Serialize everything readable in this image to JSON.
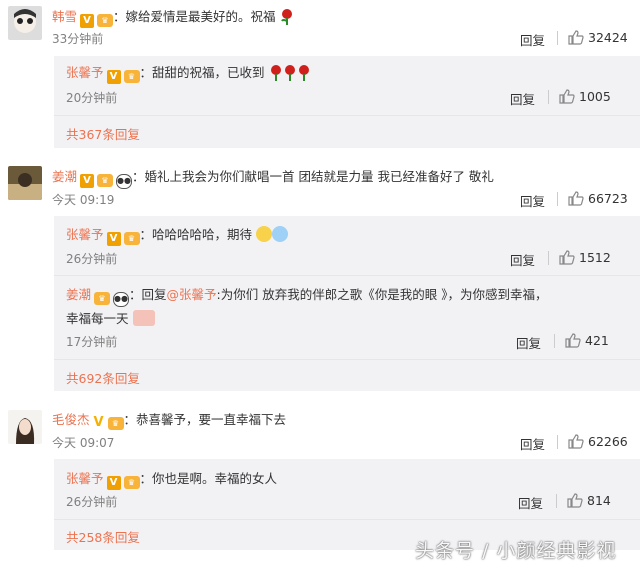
{
  "comments": [
    {
      "user": "韩雪",
      "text": "：嫁给爱情是最美好的。祝福",
      "time": "33分钟前",
      "reply_label": "回复",
      "likes": "32424",
      "subs": [
        {
          "user": "张馨予",
          "text": "：甜甜的祝福，已收到",
          "time": "20分钟前",
          "reply_label": "回复",
          "likes": "1005"
        }
      ],
      "more": "共367条回复"
    },
    {
      "user": "姜潮",
      "text": "：婚礼上我会为你们献唱一首 团结就是力量 我已经准备好了 敬礼",
      "time": "今天 09:19",
      "reply_label": "回复",
      "likes": "66723",
      "subs": [
        {
          "user": "张馨予",
          "text": "：哈哈哈哈哈，期待",
          "time": "26分钟前",
          "reply_label": "回复",
          "likes": "1512"
        },
        {
          "user": "姜潮",
          "reply_prefix": "：回复",
          "mention": "@张馨予",
          "text": ":为你们 放弃我的伴郎之歌《你是我的眼 》，为你感到幸福，",
          "text2": "幸福每一天",
          "time": "17分钟前",
          "reply_label": "回复",
          "likes": "421"
        }
      ],
      "more": "共692条回复"
    },
    {
      "user": "毛俊杰",
      "text": "：恭喜馨予，要一直幸福下去",
      "time": "今天 09:07",
      "reply_label": "回复",
      "likes": "62266",
      "subs": [
        {
          "user": "张馨予",
          "text": "：你也是啊。幸福的女人",
          "time": "26分钟前",
          "reply_label": "回复",
          "likes": "814"
        }
      ],
      "more": "共258条回复"
    }
  ],
  "watermark": "头条号 / 小颜经典影视",
  "colors": {
    "name": "#eb7350",
    "subbox_bg": "#f2f2f5",
    "vbadge": "#f0a000"
  }
}
